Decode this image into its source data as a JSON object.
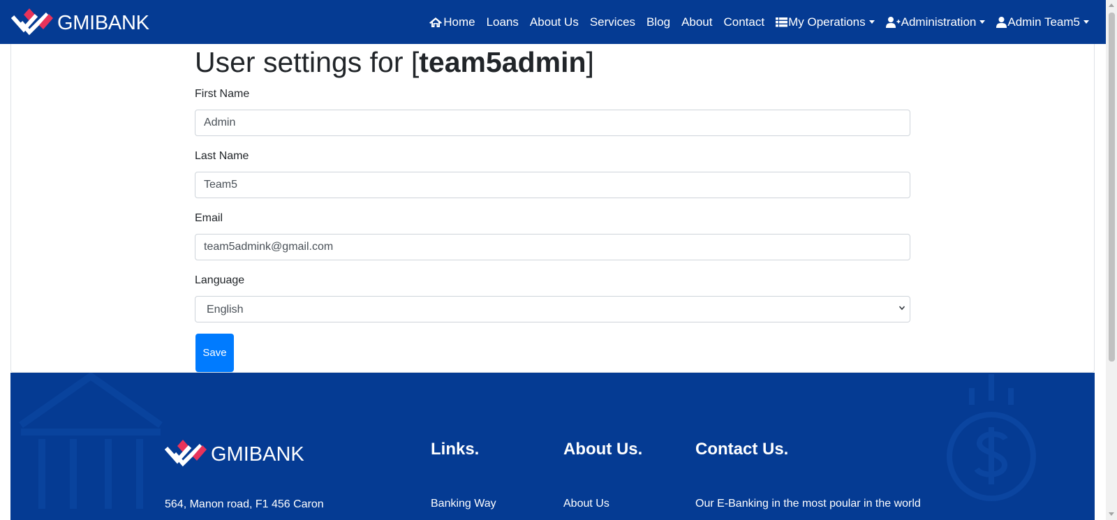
{
  "brand": {
    "name": "GMIBANK"
  },
  "nav": {
    "home": "Home",
    "loans": "Loans",
    "about_us": "About Us",
    "services": "Services",
    "blog": "Blog",
    "about": "About",
    "contact": "Contact",
    "my_operations": "My Operations",
    "administration": "Administration",
    "account": "Admin Team5"
  },
  "settings": {
    "title_prefix": "User settings for [",
    "title_user": "team5admin",
    "title_suffix": "]",
    "first_name_label": "First Name",
    "first_name_value": "Admin",
    "last_name_label": "Last Name",
    "last_name_value": "Team5",
    "email_label": "Email",
    "email_value": "team5admink@gmail.com",
    "language_label": "Language",
    "language_value": "English",
    "save_label": "Save"
  },
  "footer": {
    "brand": "GMIBANK",
    "address": "564, Manon road, F1 456 Caron",
    "links_heading": "Links.",
    "links_first": "Banking Way",
    "about_heading": "About Us.",
    "about_first": "About Us",
    "contact_heading": "Contact Us.",
    "contact_text": "Our E-Banking in the most poular in the world"
  },
  "colors": {
    "navbar": "#053b93",
    "primary_button": "#007bff",
    "logo_accent": "#e8335a"
  }
}
